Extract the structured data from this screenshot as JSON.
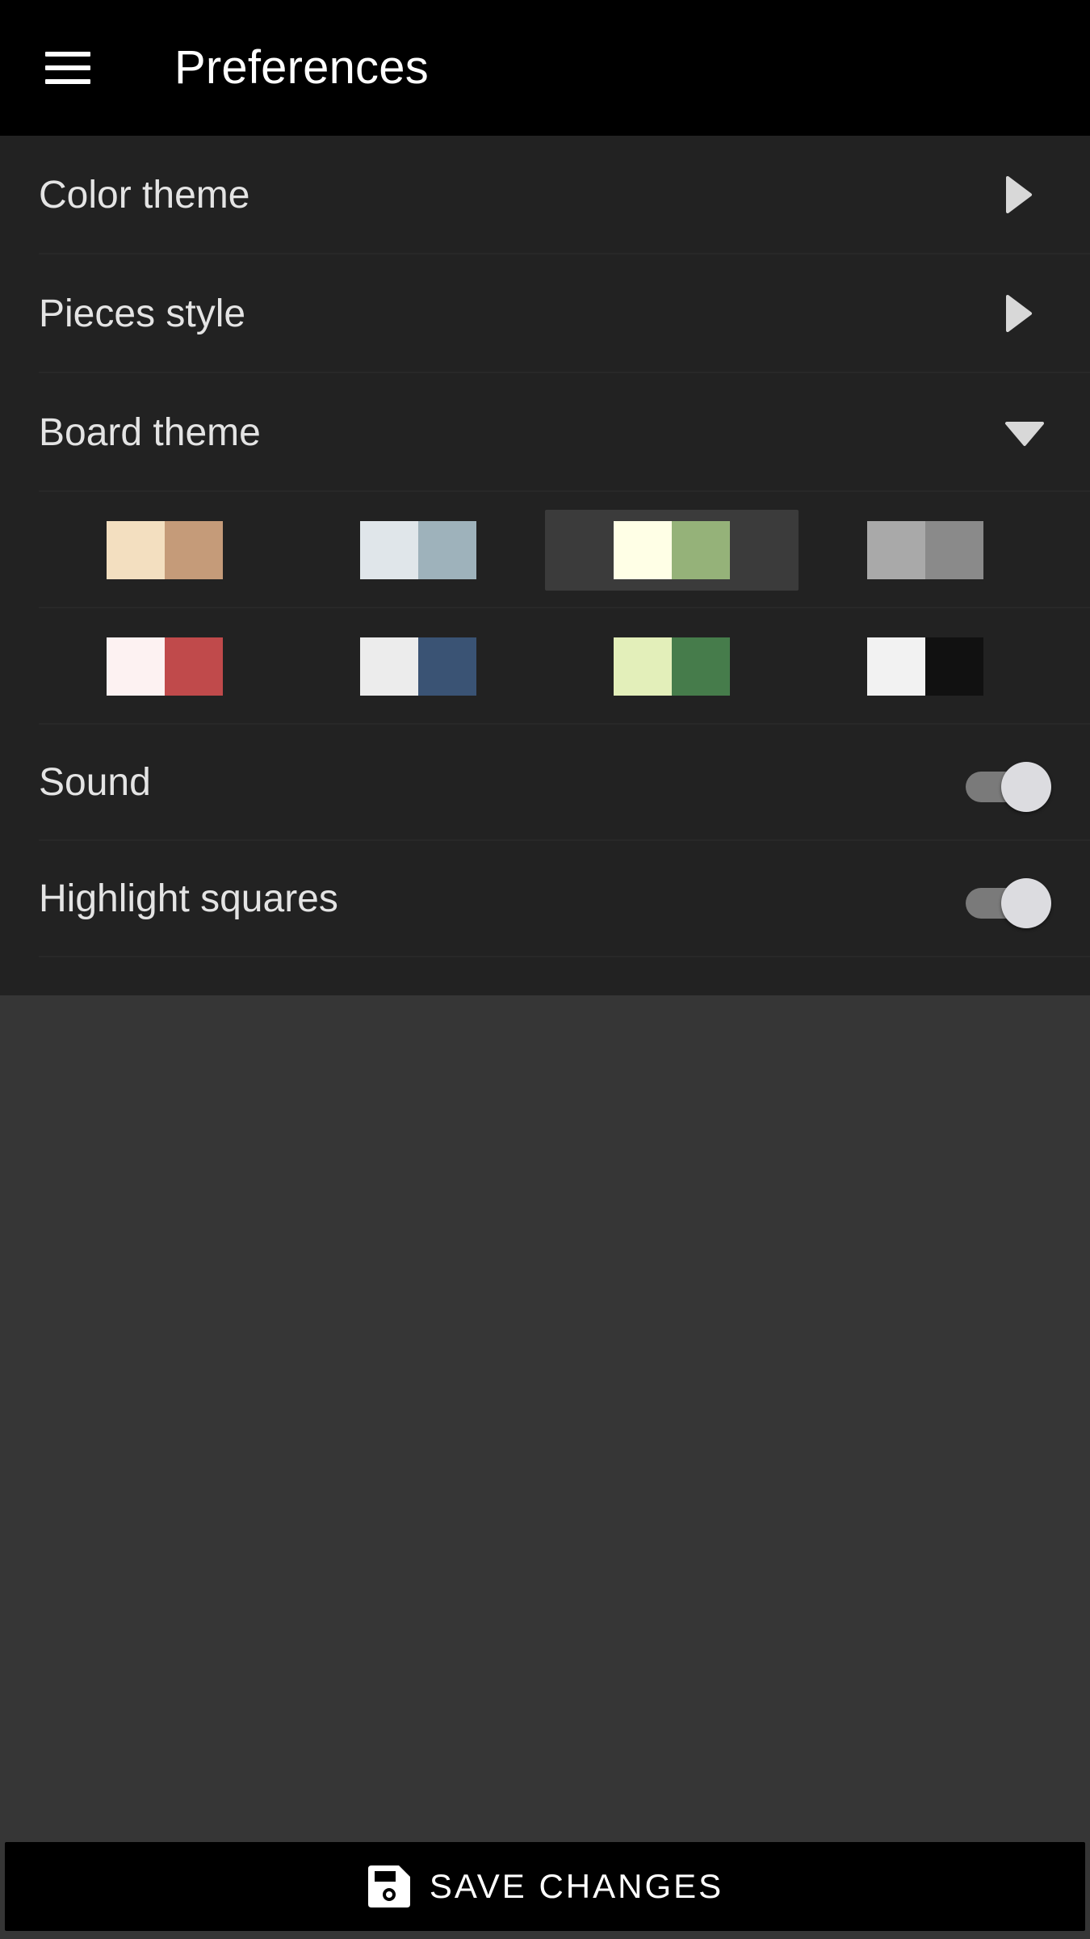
{
  "appbar": {
    "title": "Preferences",
    "menu_icon": "hamburger-menu-icon"
  },
  "preferences": {
    "color_theme": {
      "label": "Color theme",
      "icon": "chevron-right-icon",
      "expanded": false
    },
    "pieces_style": {
      "label": "Pieces style",
      "icon": "chevron-right-icon",
      "expanded": false
    },
    "board_theme": {
      "label": "Board theme",
      "icon": "chevron-down-icon",
      "expanded": true,
      "selected_index": 2,
      "options": [
        {
          "light": "#f3dfc0",
          "dark": "#c59b79"
        },
        {
          "light": "#e0e6ea",
          "dark": "#9eb2bb"
        },
        {
          "light": "#ffffe6",
          "dark": "#95b279"
        },
        {
          "light": "#a9a9a9",
          "dark": "#8a8a8a"
        },
        {
          "light": "#fdf2f2",
          "dark": "#c04a4b"
        },
        {
          "light": "#ececec",
          "dark": "#3a5374"
        },
        {
          "light": "#e3efba",
          "dark": "#467c4b"
        },
        {
          "light": "#f2f2f2",
          "dark": "#111111"
        }
      ]
    },
    "sound": {
      "label": "Sound",
      "enabled": true
    },
    "highlight_squares": {
      "label": "Highlight squares",
      "enabled": true
    }
  },
  "footer": {
    "save_label": "SAVE CHANGES",
    "save_icon": "floppy-disk-icon"
  },
  "colors": {
    "appbar_bg": "#000000",
    "panel_bg": "#222222",
    "page_bg": "#363636",
    "selected_swatch_bg": "#3b3b3b",
    "toggle_knob": "#dcdce0"
  }
}
